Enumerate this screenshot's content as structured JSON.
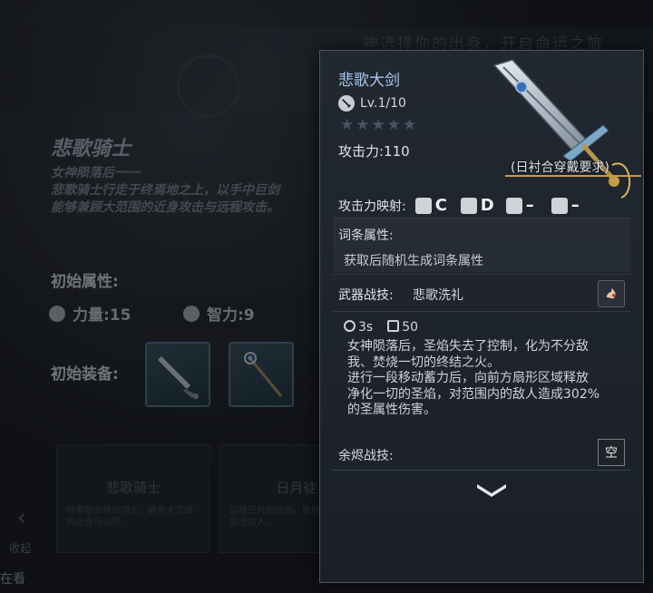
{
  "background": {
    "top_text": "神选择你的出身，开启命运之旅",
    "class_title": "悲歌骑士",
    "class_lines": [
      "女神陨落后一一",
      "悲歌骑士行走于终焉地之上，以手中巨剑",
      "能够兼顾大范围的近身攻击与远程攻击。"
    ],
    "initial_attributes_label": "初始属性:",
    "stats": [
      {
        "label": "力量:15",
        "icon": "fist-icon"
      },
      {
        "label": "智力:9",
        "icon": "head-icon"
      }
    ],
    "initial_equipment_label": "初始装备:",
    "cards": [
      {
        "title": "悲歌骑士",
        "desc": "侍奉歌女神的骑士，拥有大范围的近身与远程..."
      },
      {
        "title": "日月徒",
        "desc": "追随日月的信徒，能够利用法术攻击敌人..."
      }
    ],
    "back_label": "收起",
    "bottom_label": "在看"
  },
  "item": {
    "name": "悲歌大剑",
    "level": "Lv.1/10",
    "stars": "★★★★★",
    "attack": "攻击力:110",
    "requirement": "(日衬合穿戴要求)",
    "scaling_label": "攻击力映射:",
    "scaling": [
      {
        "icon": "fist-icon",
        "grade": "C"
      },
      {
        "icon": "boot-icon",
        "grade": "D"
      },
      {
        "icon": "head-icon",
        "grade": "–"
      },
      {
        "icon": "figure-icon",
        "grade": "–"
      }
    ],
    "affix_label": "词条属性:",
    "affix_desc": "获取后随机生成词条属性",
    "skill_label": "武器战技:",
    "skill_name": "悲歌洗礼",
    "cooldown": "3s",
    "cost": "50",
    "description": [
      "女神陨落后，圣焰失去了控制，化为不分敌",
      "我、焚烧一切的终结之火。",
      "进行一段移动蓄力后，向前方扇形区域释放",
      "净化一切的圣焰，对范围内的敌人造成302%",
      "的圣属性伤害。"
    ],
    "ember_label": "余烬战技:",
    "empty_label": "空"
  },
  "colors": {
    "item_name": "#a9c8ec",
    "requirement_underline": "#c89c45",
    "panel_border": "#4b5562"
  }
}
